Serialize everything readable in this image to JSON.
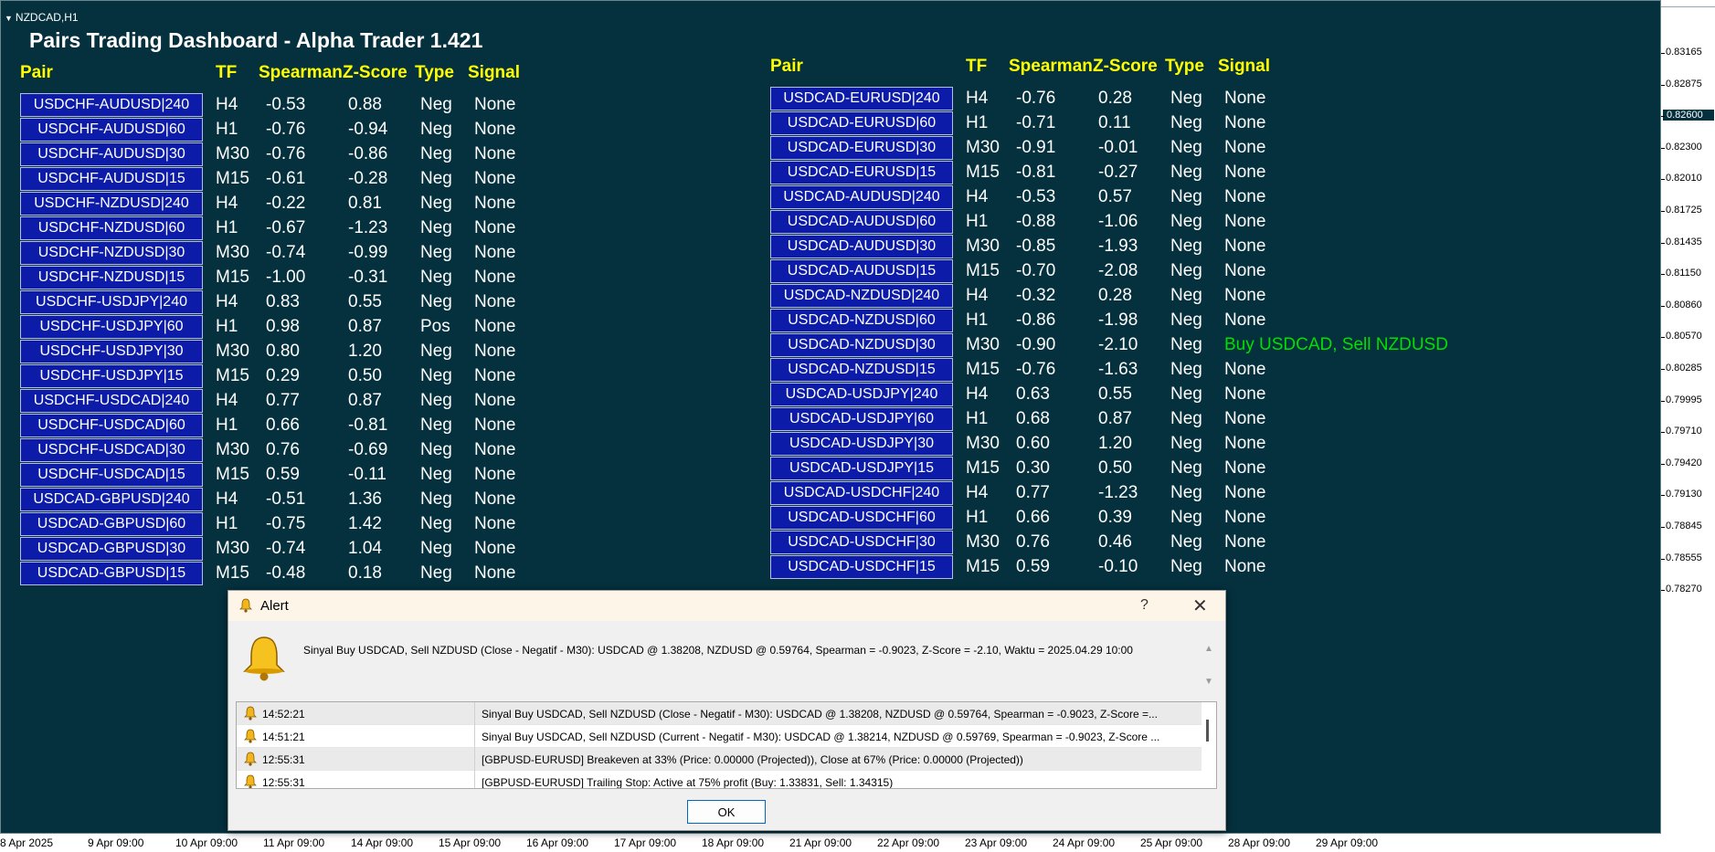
{
  "symbol": "NZDCAD,H1",
  "dashboard_title": "Pairs Trading Dashboard - Alpha Trader 1.421",
  "headers": {
    "pair": "Pair",
    "tf": "TF",
    "spearman": "Spearman",
    "zscore": "Z-Score",
    "type": "Type",
    "signal": "Signal"
  },
  "left_rows": [
    [
      "USDCHF-AUDUSD|240",
      "H4",
      "-0.53",
      "0.88",
      "Neg",
      "None"
    ],
    [
      "USDCHF-AUDUSD|60",
      "H1",
      "-0.76",
      "-0.94",
      "Neg",
      "None"
    ],
    [
      "USDCHF-AUDUSD|30",
      "M30",
      "-0.76",
      "-0.86",
      "Neg",
      "None"
    ],
    [
      "USDCHF-AUDUSD|15",
      "M15",
      "-0.61",
      "-0.28",
      "Neg",
      "None"
    ],
    [
      "USDCHF-NZDUSD|240",
      "H4",
      "-0.22",
      "0.81",
      "Neg",
      "None"
    ],
    [
      "USDCHF-NZDUSD|60",
      "H1",
      "-0.67",
      "-1.23",
      "Neg",
      "None"
    ],
    [
      "USDCHF-NZDUSD|30",
      "M30",
      "-0.74",
      "-0.99",
      "Neg",
      "None"
    ],
    [
      "USDCHF-NZDUSD|15",
      "M15",
      "-1.00",
      "-0.31",
      "Neg",
      "None"
    ],
    [
      "USDCHF-USDJPY|240",
      "H4",
      "0.83",
      "0.55",
      "Neg",
      "None"
    ],
    [
      "USDCHF-USDJPY|60",
      "H1",
      "0.98",
      "0.87",
      "Pos",
      "None"
    ],
    [
      "USDCHF-USDJPY|30",
      "M30",
      "0.80",
      "1.20",
      "Neg",
      "None"
    ],
    [
      "USDCHF-USDJPY|15",
      "M15",
      "0.29",
      "0.50",
      "Neg",
      "None"
    ],
    [
      "USDCHF-USDCAD|240",
      "H4",
      "0.77",
      "0.87",
      "Neg",
      "None"
    ],
    [
      "USDCHF-USDCAD|60",
      "H1",
      "0.66",
      "-0.81",
      "Neg",
      "None"
    ],
    [
      "USDCHF-USDCAD|30",
      "M30",
      "0.76",
      "-0.69",
      "Neg",
      "None"
    ],
    [
      "USDCHF-USDCAD|15",
      "M15",
      "0.59",
      "-0.11",
      "Neg",
      "None"
    ],
    [
      "USDCAD-GBPUSD|240",
      "H4",
      "-0.51",
      "1.36",
      "Neg",
      "None"
    ],
    [
      "USDCAD-GBPUSD|60",
      "H1",
      "-0.75",
      "1.42",
      "Neg",
      "None"
    ],
    [
      "USDCAD-GBPUSD|30",
      "M30",
      "-0.74",
      "1.04",
      "Neg",
      "None"
    ],
    [
      "USDCAD-GBPUSD|15",
      "M15",
      "-0.48",
      "0.18",
      "Neg",
      "None"
    ]
  ],
  "right_rows": [
    [
      "USDCAD-EURUSD|240",
      "H4",
      "-0.76",
      "0.28",
      "Neg",
      "None"
    ],
    [
      "USDCAD-EURUSD|60",
      "H1",
      "-0.71",
      "0.11",
      "Neg",
      "None"
    ],
    [
      "USDCAD-EURUSD|30",
      "M30",
      "-0.91",
      "-0.01",
      "Neg",
      "None"
    ],
    [
      "USDCAD-EURUSD|15",
      "M15",
      "-0.81",
      "-0.27",
      "Neg",
      "None"
    ],
    [
      "USDCAD-AUDUSD|240",
      "H4",
      "-0.53",
      "0.57",
      "Neg",
      "None"
    ],
    [
      "USDCAD-AUDUSD|60",
      "H1",
      "-0.88",
      "-1.06",
      "Neg",
      "None"
    ],
    [
      "USDCAD-AUDUSD|30",
      "M30",
      "-0.85",
      "-1.93",
      "Neg",
      "None"
    ],
    [
      "USDCAD-AUDUSD|15",
      "M15",
      "-0.70",
      "-2.08",
      "Neg",
      "None"
    ],
    [
      "USDCAD-NZDUSD|240",
      "H4",
      "-0.32",
      "0.28",
      "Neg",
      "None"
    ],
    [
      "USDCAD-NZDUSD|60",
      "H1",
      "-0.86",
      "-1.98",
      "Neg",
      "None"
    ],
    [
      "USDCAD-NZDUSD|30",
      "M30",
      "-0.90",
      "-2.10",
      "Neg",
      "Buy USDCAD, Sell NZDUSD"
    ],
    [
      "USDCAD-NZDUSD|15",
      "M15",
      "-0.76",
      "-1.63",
      "Neg",
      "None"
    ],
    [
      "USDCAD-USDJPY|240",
      "H4",
      "0.63",
      "0.55",
      "Neg",
      "None"
    ],
    [
      "USDCAD-USDJPY|60",
      "H1",
      "0.68",
      "0.87",
      "Neg",
      "None"
    ],
    [
      "USDCAD-USDJPY|30",
      "M30",
      "0.60",
      "1.20",
      "Neg",
      "None"
    ],
    [
      "USDCAD-USDJPY|15",
      "M15",
      "0.30",
      "0.50",
      "Neg",
      "None"
    ],
    [
      "USDCAD-USDCHF|240",
      "H4",
      "0.77",
      "-1.23",
      "Neg",
      "None"
    ],
    [
      "USDCAD-USDCHF|60",
      "H1",
      "0.66",
      "0.39",
      "Neg",
      "None"
    ],
    [
      "USDCAD-USDCHF|30",
      "M30",
      "0.76",
      "0.46",
      "Neg",
      "None"
    ],
    [
      "USDCAD-USDCHF|15",
      "M15",
      "0.59",
      "-0.10",
      "Neg",
      "None"
    ]
  ],
  "price_axis": [
    "0.83165",
    "0.82875",
    "0.82600",
    "0.82300",
    "0.82010",
    "0.81725",
    "0.81435",
    "0.81150",
    "0.80860",
    "0.80570",
    "0.80285",
    "0.79995",
    "0.79710",
    "0.79420",
    "0.79130",
    "0.78845",
    "0.78555",
    "0.78270"
  ],
  "current_price": "0.82600",
  "time_axis": [
    "8 Apr 2025",
    "9 Apr 09:00",
    "10 Apr 09:00",
    "11 Apr 09:00",
    "14 Apr 09:00",
    "15 Apr 09:00",
    "16 Apr 09:00",
    "17 Apr 09:00",
    "18 Apr 09:00",
    "21 Apr 09:00",
    "22 Apr 09:00",
    "23 Apr 09:00",
    "24 Apr 09:00",
    "25 Apr 09:00",
    "28 Apr 09:00",
    "29 Apr 09:00"
  ],
  "alert": {
    "title": "Alert",
    "help": "?",
    "close": "✕",
    "message": "Sinyal Buy USDCAD, Sell NZDUSD (Close - Negatif - M30): USDCAD @ 1.38208, NZDUSD @ 0.59764, Spearman = -0.9023, Z-Score = -2.10, Waktu = 2025.04.29 10:00",
    "list": [
      {
        "time": "14:52:21",
        "text": "Sinyal Buy USDCAD, Sell NZDUSD (Close - Negatif - M30): USDCAD @ 1.38208, NZDUSD @ 0.59764, Spearman = -0.9023, Z-Score =..."
      },
      {
        "time": "14:51:21",
        "text": "Sinyal Buy USDCAD, Sell NZDUSD (Current - Negatif - M30): USDCAD @ 1.38214, NZDUSD @ 0.59769, Spearman = -0.9023, Z-Score ..."
      },
      {
        "time": "12:55:31",
        "text": "[GBPUSD-EURUSD] Breakeven at 33% (Price: 0.00000 (Projected)), Close at 67% (Price: 0.00000 (Projected))"
      },
      {
        "time": "12:55:31",
        "text": "[GBPUSD-EURUSD] Trailing Stop: Active at 75% profit (Buy: 1.33831, Sell: 1.34315)"
      }
    ],
    "ok_label": "OK"
  },
  "colors": {
    "chart_bg": "#05303d",
    "header": "#ffff00",
    "pair_button": "#0c1ca8",
    "signal_active": "#00e000"
  }
}
